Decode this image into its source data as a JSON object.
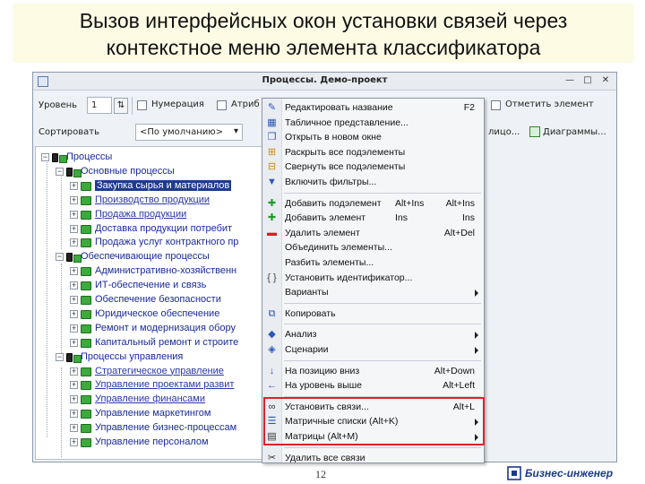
{
  "slide": {
    "title_line1": "Вызов интерфейсных окон установки связей через",
    "title_line2": "контекстное меню элемента классификатора",
    "page_number": "12",
    "brand": "Бизнес-инженер"
  },
  "window": {
    "title": "Процессы. Демо-проект",
    "minimize": "—",
    "maximize": "□",
    "close": "✕"
  },
  "toolbar": {
    "level_label": "Уровень",
    "level_value": "1",
    "numbering": "Нумерация",
    "attributes": "Атриб",
    "mark_element": "Отметить элемент",
    "sorting_label": "Сортировать",
    "sorting_value": "<По умолчанию>",
    "sorting_arrow": "▾",
    "cut_text": "лицо...",
    "diagrams": "Диаграммы..."
  },
  "tree": {
    "items": [
      {
        "label": "Процессы",
        "expander": "−",
        "level": 0,
        "kind": "group"
      },
      {
        "label": "Основные процессы",
        "expander": "−",
        "level": 1,
        "kind": "group"
      },
      {
        "label": "Закупка сырья и материалов",
        "expander": "+",
        "level": 2,
        "kind": "selected"
      },
      {
        "label": "Производство продукции",
        "expander": "+",
        "level": 2,
        "kind": "link"
      },
      {
        "label": "Продажа продукции",
        "expander": "+",
        "level": 2,
        "kind": "link"
      },
      {
        "label": "Доставка продукции потребит",
        "expander": "+",
        "level": 2,
        "kind": "plain"
      },
      {
        "label": "Продажа услуг контрактного пр",
        "expander": "+",
        "level": 2,
        "kind": "plain"
      },
      {
        "label": "Обеспечивающие процессы",
        "expander": "−",
        "level": 1,
        "kind": "group"
      },
      {
        "label": "Административно-хозяйственн",
        "expander": "+",
        "level": 2,
        "kind": "plain"
      },
      {
        "label": "ИТ-обеспечение и связь",
        "expander": "+",
        "level": 2,
        "kind": "plain"
      },
      {
        "label": "Обеспечение безопасности",
        "expander": "+",
        "level": 2,
        "kind": "plain"
      },
      {
        "label": "Юридическое обеспечение",
        "expander": "+",
        "level": 2,
        "kind": "plain"
      },
      {
        "label": "Ремонт и модернизация обору",
        "expander": "+",
        "level": 2,
        "kind": "plain"
      },
      {
        "label": "Капитальный ремонт и строите",
        "expander": "+",
        "level": 2,
        "kind": "plain"
      },
      {
        "label": "Процессы управления",
        "expander": "−",
        "level": 1,
        "kind": "group"
      },
      {
        "label": "Стратегическое управление",
        "expander": "+",
        "level": 2,
        "kind": "link"
      },
      {
        "label": "Управление проектами развит",
        "expander": "+",
        "level": 2,
        "kind": "link"
      },
      {
        "label": "Управление финансами",
        "expander": "+",
        "level": 2,
        "kind": "link"
      },
      {
        "label": "Управление маркетингом",
        "expander": "+",
        "level": 2,
        "kind": "plain"
      },
      {
        "label": "Управление бизнес-процессам",
        "expander": "+",
        "level": 2,
        "kind": "plain"
      },
      {
        "label": "Управление персоналом",
        "expander": "+",
        "level": 2,
        "kind": "plain"
      }
    ]
  },
  "context_menu": {
    "items": [
      {
        "label": "Редактировать название",
        "sc1": "",
        "sc2": "F2",
        "icon": "edit-icon",
        "glyph": "✎",
        "color": "#2b57b8",
        "submenu": false
      },
      {
        "label": "Табличное представление...",
        "sc1": "",
        "sc2": "",
        "icon": "table-icon",
        "glyph": "▦",
        "color": "#2b57b8",
        "submenu": false
      },
      {
        "label": "Открыть в новом окне",
        "sc1": "",
        "sc2": "",
        "icon": "new-window-icon",
        "glyph": "❐",
        "color": "#2b57b8",
        "submenu": false
      },
      {
        "label": "Раскрыть все подэлементы",
        "sc1": "",
        "sc2": "",
        "icon": "expand-all-icon",
        "glyph": "⊞",
        "color": "#c88a14",
        "submenu": false
      },
      {
        "label": "Свернуть все подэлементы",
        "sc1": "",
        "sc2": "",
        "icon": "collapse-all-icon",
        "glyph": "⊟",
        "color": "#c88a14",
        "submenu": false
      },
      {
        "label": "Включить фильтры...",
        "sc1": "",
        "sc2": "",
        "icon": "filter-icon",
        "glyph": "▼",
        "color": "#2b57b8",
        "submenu": false
      },
      {
        "sep": true
      },
      {
        "label": "Добавить подэлемент",
        "sc1": "Alt+Ins",
        "sc2": "Alt+Ins",
        "icon": "add-child-icon",
        "glyph": "✚",
        "color": "#1f9a2a",
        "submenu": false
      },
      {
        "label": "Добавить элемент",
        "sc1": "Ins",
        "sc2": "Ins",
        "icon": "add-icon",
        "glyph": "✚",
        "color": "#1f9a2a",
        "submenu": false
      },
      {
        "label": "Удалить элемент",
        "sc1": "",
        "sc2": "Alt+Del",
        "icon": "delete-icon",
        "glyph": "▬",
        "color": "#d42020",
        "submenu": false
      },
      {
        "label": "Объединить элементы...",
        "sc1": "",
        "sc2": "",
        "icon": "",
        "glyph": "",
        "color": "#222222",
        "submenu": false
      },
      {
        "label": "Разбить элементы...",
        "sc1": "",
        "sc2": "",
        "icon": "",
        "glyph": "",
        "color": "#222222",
        "submenu": false
      },
      {
        "label": "Установить идентификатор...",
        "sc1": "",
        "sc2": "",
        "icon": "id-icon",
        "glyph": "{ }",
        "color": "#444444",
        "submenu": false
      },
      {
        "label": "Варианты",
        "sc1": "",
        "sc2": "",
        "icon": "",
        "glyph": "",
        "color": "#222222",
        "submenu": true
      },
      {
        "sep": true
      },
      {
        "label": "Копировать",
        "sc1": "",
        "sc2": "",
        "icon": "copy-icon",
        "glyph": "⧉",
        "color": "#2b57b8",
        "submenu": false
      },
      {
        "sep": true
      },
      {
        "label": "Анализ",
        "sc1": "",
        "sc2": "",
        "icon": "analysis-icon",
        "glyph": "◆",
        "color": "#2b57b8",
        "submenu": true
      },
      {
        "label": "Сценарии",
        "sc1": "",
        "sc2": "",
        "icon": "scenario-icon",
        "glyph": "◈",
        "color": "#2b57b8",
        "submenu": true
      },
      {
        "sep": true
      },
      {
        "label": "На позицию вниз",
        "sc1": "",
        "sc2": "Alt+Down",
        "icon": "arrow-down-icon",
        "glyph": "↓",
        "color": "#2b57b8",
        "submenu": false
      },
      {
        "label": "На уровень выше",
        "sc1": "",
        "sc2": "Alt+Left",
        "icon": "arrow-left-icon",
        "glyph": "←",
        "color": "#2b57b8",
        "submenu": false
      },
      {
        "sep": true
      },
      {
        "label": "Установить связи...",
        "sc1": "",
        "sc2": "Alt+L",
        "icon": "link-icon",
        "glyph": "∞",
        "color": "#333333",
        "submenu": false
      },
      {
        "label": "Матричные списки (Alt+K)",
        "sc1": "",
        "sc2": "",
        "icon": "matrix-list-icon",
        "glyph": "☰",
        "color": "#2b57b8",
        "submenu": true
      },
      {
        "label": "Матрицы (Alt+M)",
        "sc1": "",
        "sc2": "",
        "icon": "matrix-icon",
        "glyph": "▤",
        "color": "#333333",
        "submenu": true
      },
      {
        "sep": true
      },
      {
        "label": "Удалить все связи",
        "sc1": "",
        "sc2": "",
        "icon": "unlink-icon",
        "glyph": "✂",
        "color": "#333333",
        "submenu": false
      }
    ]
  }
}
